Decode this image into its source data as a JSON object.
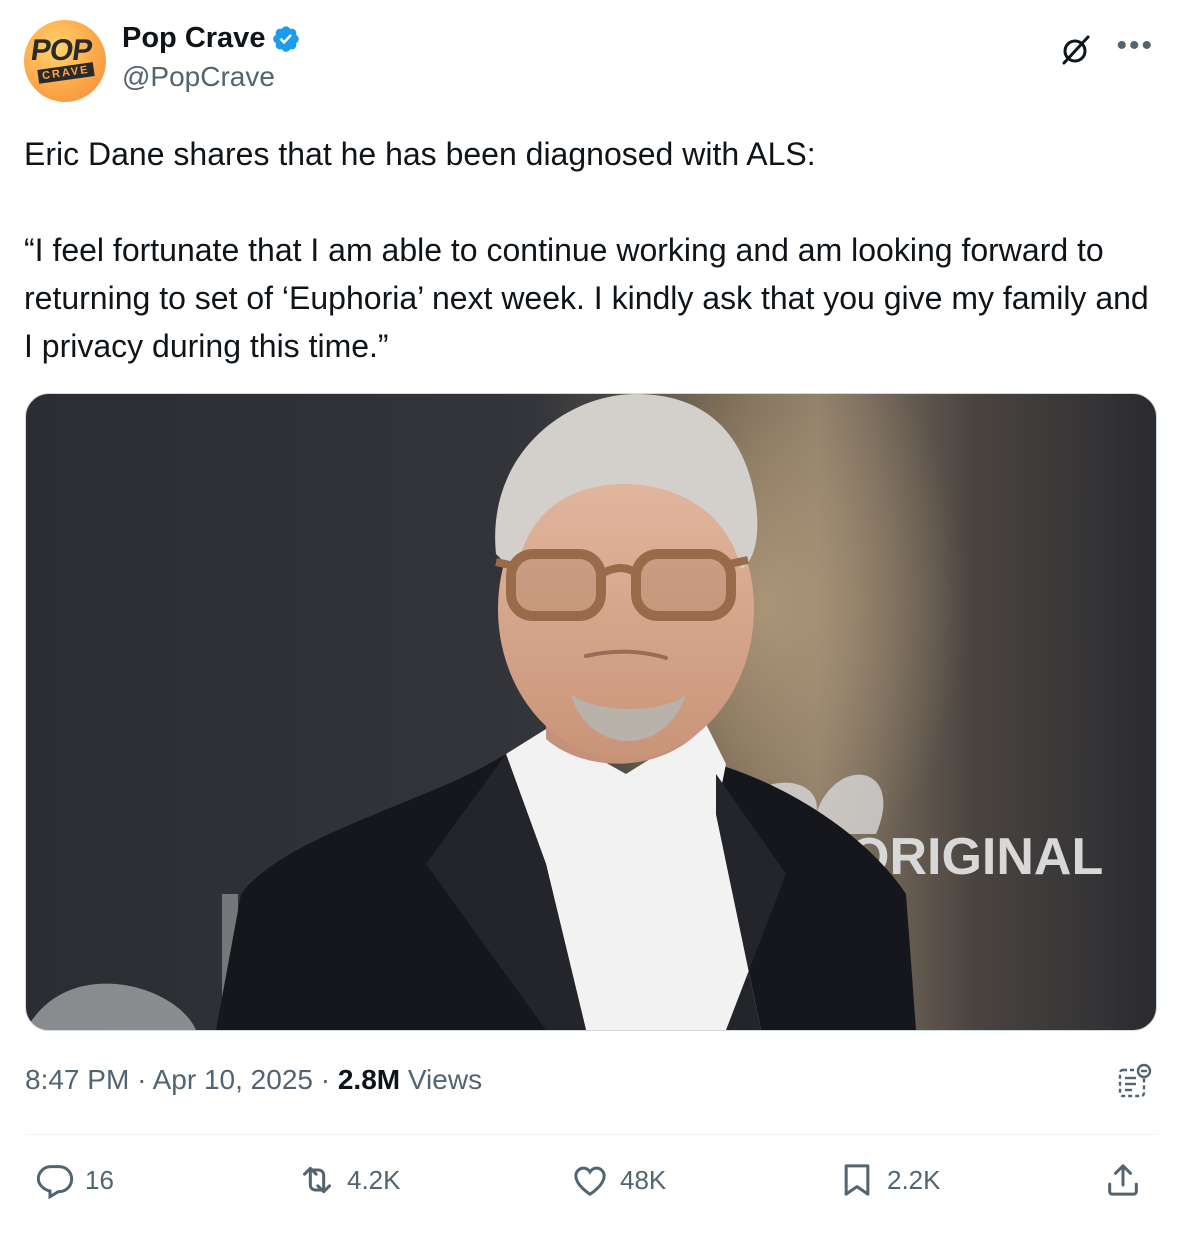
{
  "account": {
    "display_name": "Pop Crave",
    "handle": "@PopCrave",
    "verified": true,
    "avatar_text_top": "POP",
    "avatar_text_bottom": "CRAVE"
  },
  "tweet": {
    "line1": "Eric Dane shares that he has been diagnosed with ALS:",
    "quote": "“I feel fortunate that I am able to continue working and am looking forward to returning to set of ‘Euphoria’ next week. I kindly ask that you give my family and I privacy during this time.”",
    "media_sign_text": "ORIGINAL"
  },
  "meta": {
    "time": "8:47 PM",
    "separator": "·",
    "date": "Apr 10, 2025",
    "views_count": "2.8M",
    "views_label": "Views"
  },
  "actions": {
    "replies": "16",
    "reposts": "4.2K",
    "likes": "48K",
    "bookmarks": "2.2K"
  },
  "colors": {
    "text_primary": "#0f1419",
    "text_secondary": "#536471",
    "verified_blue": "#1d9bf0",
    "divider": "#eff3f4"
  },
  "icons": [
    "verified-badge-icon",
    "grok-icon",
    "more-icon",
    "analytics-icon",
    "reply-icon",
    "repost-icon",
    "like-icon",
    "bookmark-icon",
    "share-icon"
  ]
}
